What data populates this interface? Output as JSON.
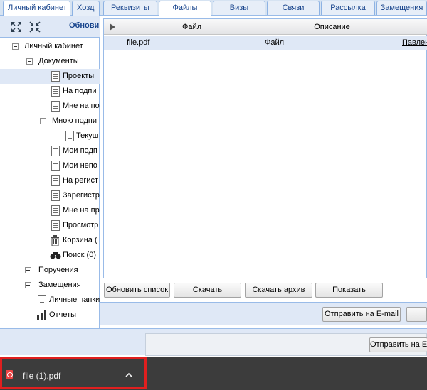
{
  "left_tabs": [
    "Личный кабинет",
    "Хозд"
  ],
  "tree_toolbar": {
    "label": "Обнови",
    "expand_icon": "expand-all-icon",
    "collapse_icon": "collapse-all-icon"
  },
  "tree": {
    "root": "Личный кабинет",
    "documents": "Документы",
    "projects": "Проекты",
    "na_podpi": "На подпи",
    "mne_na_p": "Мне на по",
    "mnoyu_podpi": "Мною подпи",
    "tekush": "Текуш",
    "moi_podp": "Мои подп",
    "moi_nep": "Мои непо",
    "na_regist": "На регист",
    "zaregistr": "Зарегистр",
    "mne_na_pr": "Мне на пр",
    "prosmotr": "Просмотр",
    "korzina": "Корзина (",
    "poisk": "Поиск (0)",
    "porucheniya": "Поручения",
    "zameshcheniya": "Замещения",
    "lichnye": "Личные папки",
    "otchety": "Отчеты"
  },
  "right_tabs": [
    "Реквизиты",
    "Файлы",
    "Визы",
    "Связи",
    "Рассылка",
    "Замещения"
  ],
  "grid": {
    "headers": [
      "Файл",
      "Описание"
    ],
    "rows": [
      {
        "file": "file.pdf",
        "desc": "Файл",
        "author": "Павлен"
      }
    ]
  },
  "buttons": {
    "refresh": "Обновить список",
    "download": "Скачать",
    "download_archive": "Скачать архив",
    "show": "Показать",
    "send_email": "Отправить на E-mail",
    "send_email_2": "Отправить на E"
  },
  "download_bar": {
    "filename": "file (1).pdf",
    "icon": "pdf-file-icon",
    "chevron": "chevron-up-icon"
  },
  "colors": {
    "highlight": "#e01f1f",
    "download_bar_bg": "#3c3c3c",
    "panel_header": "#15428b"
  }
}
